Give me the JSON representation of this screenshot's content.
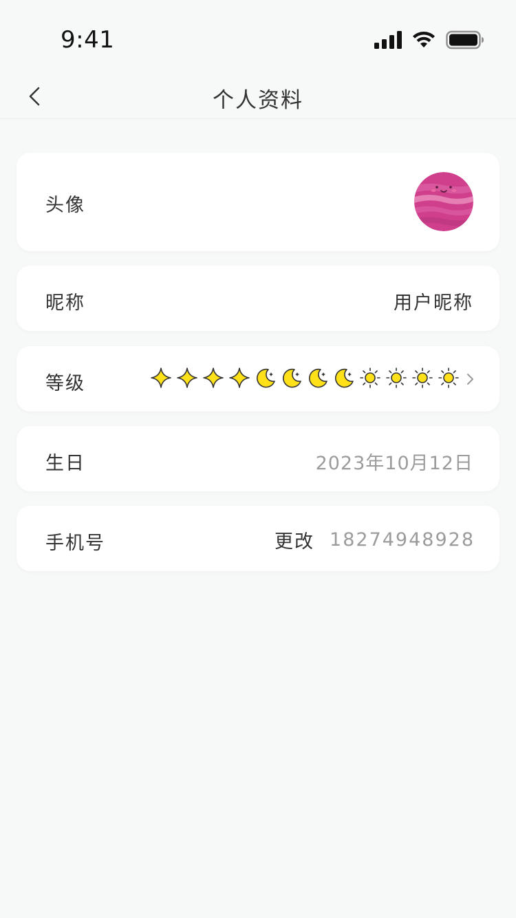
{
  "status_bar": {
    "time": "9:41",
    "icons": [
      "signal-icon",
      "wifi-icon",
      "battery-icon"
    ]
  },
  "nav": {
    "title": "个人资料",
    "back_icon": "chevron-left-icon"
  },
  "profile": {
    "avatar_label": "头像",
    "nickname_label": "昵称",
    "nickname_value": "用户昵称",
    "level_label": "等级",
    "level_icons": [
      "sparkle-icon",
      "sparkle-icon",
      "sparkle-icon",
      "sparkle-icon",
      "moon-icon",
      "moon-icon",
      "moon-icon",
      "moon-icon",
      "sun-icon",
      "sun-icon",
      "sun-icon",
      "sun-icon"
    ],
    "birthday_label": "生日",
    "birthday_value": "2023年10月12日",
    "phone_label": "手机号",
    "phone_change": "更改",
    "phone_value": "18274948928"
  },
  "colors": {
    "background": "#f7f8f8",
    "card": "#ffffff",
    "text": "#333333",
    "muted": "#9b9b9b",
    "level_icon_fill": "#ffe11a",
    "avatar": "#d44a93"
  }
}
